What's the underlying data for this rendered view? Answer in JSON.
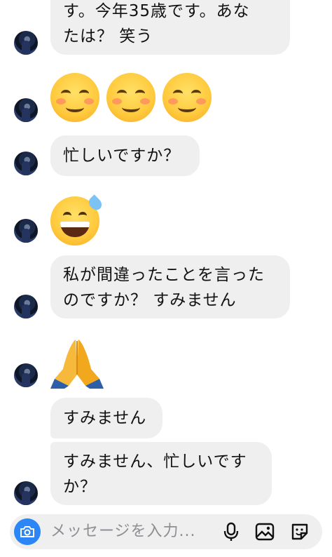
{
  "messages": [
    {
      "type": "text",
      "text": "す。今年35歳です。あな\nたは？ 笑う"
    },
    {
      "type": "emoji",
      "emoji": "smiling-face-with-smiling-eyes x3"
    },
    {
      "type": "text",
      "text": "忙しいですか？"
    },
    {
      "type": "emoji",
      "emoji": "grinning-face-with-sweat"
    },
    {
      "type": "text",
      "text": "私が間違ったことを言った\nのですか？ すみません"
    },
    {
      "type": "emoji",
      "emoji": "folded-hands"
    },
    {
      "type": "text",
      "text": "すみません"
    },
    {
      "type": "text",
      "text": "すみません、忙しいです\nか？"
    }
  ],
  "composer": {
    "placeholder": "メッセージを入力...",
    "icons": [
      "camera-icon",
      "microphone-icon",
      "image-icon",
      "sticker-icon"
    ]
  },
  "colors": {
    "bubble": "#efeff0",
    "accent": "#2d86f5",
    "background": "#ffffff"
  }
}
